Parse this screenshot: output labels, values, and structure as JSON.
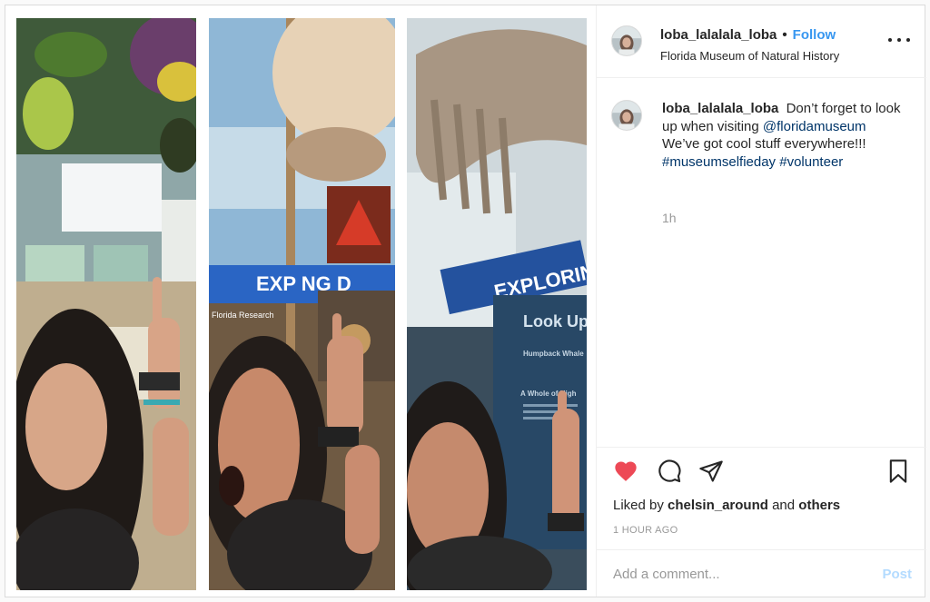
{
  "post": {
    "username": "loba_lalalala_loba",
    "separator": "•",
    "follow_label": "Follow",
    "location": "Florida Museum of Natural History",
    "more_icon": "more-options-icon"
  },
  "caption": {
    "username": "loba_lalalala_loba",
    "text_part1": "Don’t forget to look up when visiting",
    "mention": "@floridamuseum",
    "text_part2": "We’ve got cool stuff everywhere!!!",
    "hashtag1": "#museumselfieday",
    "hashtag2": "#volunteer",
    "time": "1h"
  },
  "actions": {
    "like_icon": "heart-filled-icon",
    "comment_icon": "comment-icon",
    "share_icon": "share-icon",
    "save_icon": "bookmark-icon",
    "like_color": "#ed4956"
  },
  "likes": {
    "prefix": "Liked by",
    "user": "chelsin_around",
    "and": "and",
    "others": "others"
  },
  "timestamp": "1 HOUR AGO",
  "comment_box": {
    "placeholder": "Add a comment...",
    "post_label": "Post"
  },
  "image_text": {
    "banner1": "EXPLORING",
    "banner2": "EXPLORING",
    "sign_title": "Look Up",
    "sign_sub1": "Humpback Whale",
    "sign_sub2": "A Whole of High",
    "sign_small": "Florida Research",
    "banner1_partial": "EXP    NG    D"
  }
}
